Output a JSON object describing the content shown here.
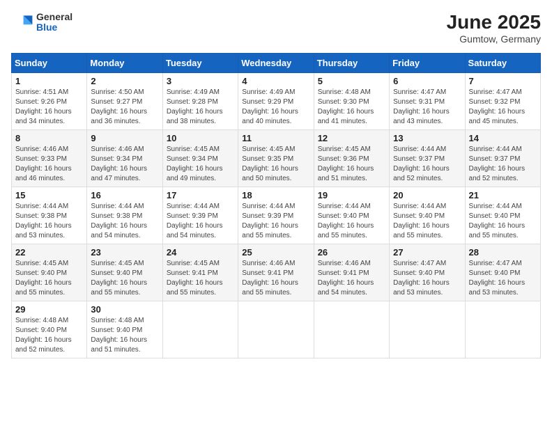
{
  "header": {
    "logo": {
      "general": "General",
      "blue": "Blue"
    },
    "title": "June 2025",
    "subtitle": "Gumtow, Germany"
  },
  "days_of_week": [
    "Sunday",
    "Monday",
    "Tuesday",
    "Wednesday",
    "Thursday",
    "Friday",
    "Saturday"
  ],
  "weeks": [
    [
      {
        "day": 1,
        "lines": [
          "Sunrise: 4:51 AM",
          "Sunset: 9:26 PM",
          "Daylight: 16 hours",
          "and 34 minutes."
        ]
      },
      {
        "day": 2,
        "lines": [
          "Sunrise: 4:50 AM",
          "Sunset: 9:27 PM",
          "Daylight: 16 hours",
          "and 36 minutes."
        ]
      },
      {
        "day": 3,
        "lines": [
          "Sunrise: 4:49 AM",
          "Sunset: 9:28 PM",
          "Daylight: 16 hours",
          "and 38 minutes."
        ]
      },
      {
        "day": 4,
        "lines": [
          "Sunrise: 4:49 AM",
          "Sunset: 9:29 PM",
          "Daylight: 16 hours",
          "and 40 minutes."
        ]
      },
      {
        "day": 5,
        "lines": [
          "Sunrise: 4:48 AM",
          "Sunset: 9:30 PM",
          "Daylight: 16 hours",
          "and 41 minutes."
        ]
      },
      {
        "day": 6,
        "lines": [
          "Sunrise: 4:47 AM",
          "Sunset: 9:31 PM",
          "Daylight: 16 hours",
          "and 43 minutes."
        ]
      },
      {
        "day": 7,
        "lines": [
          "Sunrise: 4:47 AM",
          "Sunset: 9:32 PM",
          "Daylight: 16 hours",
          "and 45 minutes."
        ]
      }
    ],
    [
      {
        "day": 8,
        "lines": [
          "Sunrise: 4:46 AM",
          "Sunset: 9:33 PM",
          "Daylight: 16 hours",
          "and 46 minutes."
        ]
      },
      {
        "day": 9,
        "lines": [
          "Sunrise: 4:46 AM",
          "Sunset: 9:34 PM",
          "Daylight: 16 hours",
          "and 47 minutes."
        ]
      },
      {
        "day": 10,
        "lines": [
          "Sunrise: 4:45 AM",
          "Sunset: 9:34 PM",
          "Daylight: 16 hours",
          "and 49 minutes."
        ]
      },
      {
        "day": 11,
        "lines": [
          "Sunrise: 4:45 AM",
          "Sunset: 9:35 PM",
          "Daylight: 16 hours",
          "and 50 minutes."
        ]
      },
      {
        "day": 12,
        "lines": [
          "Sunrise: 4:45 AM",
          "Sunset: 9:36 PM",
          "Daylight: 16 hours",
          "and 51 minutes."
        ]
      },
      {
        "day": 13,
        "lines": [
          "Sunrise: 4:44 AM",
          "Sunset: 9:37 PM",
          "Daylight: 16 hours",
          "and 52 minutes."
        ]
      },
      {
        "day": 14,
        "lines": [
          "Sunrise: 4:44 AM",
          "Sunset: 9:37 PM",
          "Daylight: 16 hours",
          "and 52 minutes."
        ]
      }
    ],
    [
      {
        "day": 15,
        "lines": [
          "Sunrise: 4:44 AM",
          "Sunset: 9:38 PM",
          "Daylight: 16 hours",
          "and 53 minutes."
        ]
      },
      {
        "day": 16,
        "lines": [
          "Sunrise: 4:44 AM",
          "Sunset: 9:38 PM",
          "Daylight: 16 hours",
          "and 54 minutes."
        ]
      },
      {
        "day": 17,
        "lines": [
          "Sunrise: 4:44 AM",
          "Sunset: 9:39 PM",
          "Daylight: 16 hours",
          "and 54 minutes."
        ]
      },
      {
        "day": 18,
        "lines": [
          "Sunrise: 4:44 AM",
          "Sunset: 9:39 PM",
          "Daylight: 16 hours",
          "and 55 minutes."
        ]
      },
      {
        "day": 19,
        "lines": [
          "Sunrise: 4:44 AM",
          "Sunset: 9:40 PM",
          "Daylight: 16 hours",
          "and 55 minutes."
        ]
      },
      {
        "day": 20,
        "lines": [
          "Sunrise: 4:44 AM",
          "Sunset: 9:40 PM",
          "Daylight: 16 hours",
          "and 55 minutes."
        ]
      },
      {
        "day": 21,
        "lines": [
          "Sunrise: 4:44 AM",
          "Sunset: 9:40 PM",
          "Daylight: 16 hours",
          "and 55 minutes."
        ]
      }
    ],
    [
      {
        "day": 22,
        "lines": [
          "Sunrise: 4:45 AM",
          "Sunset: 9:40 PM",
          "Daylight: 16 hours",
          "and 55 minutes."
        ]
      },
      {
        "day": 23,
        "lines": [
          "Sunrise: 4:45 AM",
          "Sunset: 9:40 PM",
          "Daylight: 16 hours",
          "and 55 minutes."
        ]
      },
      {
        "day": 24,
        "lines": [
          "Sunrise: 4:45 AM",
          "Sunset: 9:41 PM",
          "Daylight: 16 hours",
          "and 55 minutes."
        ]
      },
      {
        "day": 25,
        "lines": [
          "Sunrise: 4:46 AM",
          "Sunset: 9:41 PM",
          "Daylight: 16 hours",
          "and 55 minutes."
        ]
      },
      {
        "day": 26,
        "lines": [
          "Sunrise: 4:46 AM",
          "Sunset: 9:41 PM",
          "Daylight: 16 hours",
          "and 54 minutes."
        ]
      },
      {
        "day": 27,
        "lines": [
          "Sunrise: 4:47 AM",
          "Sunset: 9:40 PM",
          "Daylight: 16 hours",
          "and 53 minutes."
        ]
      },
      {
        "day": 28,
        "lines": [
          "Sunrise: 4:47 AM",
          "Sunset: 9:40 PM",
          "Daylight: 16 hours",
          "and 53 minutes."
        ]
      }
    ],
    [
      {
        "day": 29,
        "lines": [
          "Sunrise: 4:48 AM",
          "Sunset: 9:40 PM",
          "Daylight: 16 hours",
          "and 52 minutes."
        ]
      },
      {
        "day": 30,
        "lines": [
          "Sunrise: 4:48 AM",
          "Sunset: 9:40 PM",
          "Daylight: 16 hours",
          "and 51 minutes."
        ]
      },
      null,
      null,
      null,
      null,
      null
    ]
  ]
}
